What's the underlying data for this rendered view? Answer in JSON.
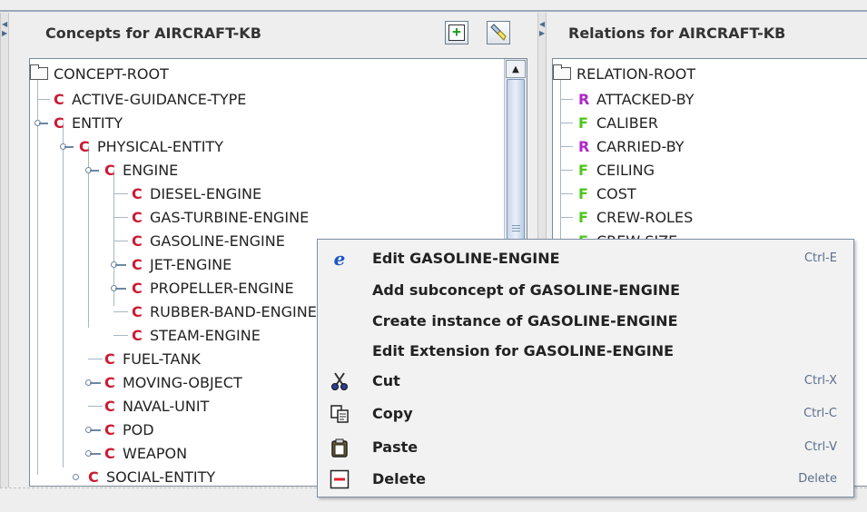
{
  "concepts_panel": {
    "title": "Concepts for AIRCRAFT-KB",
    "add_button_glyph": "+",
    "root": "CONCEPT-ROOT",
    "items": [
      {
        "tag": "C",
        "label": "ACTIVE-GUIDANCE-TYPE"
      },
      {
        "tag": "C",
        "label": "ENTITY"
      },
      {
        "tag": "C",
        "label": "PHYSICAL-ENTITY"
      },
      {
        "tag": "C",
        "label": "ENGINE"
      },
      {
        "tag": "C",
        "label": "DIESEL-ENGINE"
      },
      {
        "tag": "C",
        "label": "GAS-TURBINE-ENGINE"
      },
      {
        "tag": "C",
        "label": "GASOLINE-ENGINE"
      },
      {
        "tag": "C",
        "label": "JET-ENGINE"
      },
      {
        "tag": "C",
        "label": "PROPELLER-ENGINE"
      },
      {
        "tag": "C",
        "label": "RUBBER-BAND-ENGINE"
      },
      {
        "tag": "C",
        "label": "STEAM-ENGINE"
      },
      {
        "tag": "C",
        "label": "FUEL-TANK"
      },
      {
        "tag": "C",
        "label": "MOVING-OBJECT"
      },
      {
        "tag": "C",
        "label": "NAVAL-UNIT"
      },
      {
        "tag": "C",
        "label": "POD"
      },
      {
        "tag": "C",
        "label": "WEAPON"
      },
      {
        "tag": "C",
        "label": "SOCIAL-ENTITY"
      }
    ]
  },
  "relations_panel": {
    "title": "Relations for AIRCRAFT-KB",
    "root": "RELATION-ROOT",
    "items": [
      {
        "tag": "R",
        "label": "ATTACKED-BY"
      },
      {
        "tag": "F",
        "label": "CALIBER"
      },
      {
        "tag": "R",
        "label": "CARRIED-BY"
      },
      {
        "tag": "F",
        "label": "CEILING"
      },
      {
        "tag": "F",
        "label": "COST"
      },
      {
        "tag": "F",
        "label": "CREW-ROLES"
      },
      {
        "tag": "F",
        "label": "CREW-SIZE"
      }
    ]
  },
  "context_menu": {
    "items": [
      {
        "icon": "edit-e-icon",
        "label": "Edit GASOLINE-ENGINE",
        "accelerator": "Ctrl-E"
      },
      {
        "icon": "",
        "label": "Add subconcept of GASOLINE-ENGINE",
        "accelerator": ""
      },
      {
        "icon": "",
        "label": "Create instance of GASOLINE-ENGINE",
        "accelerator": ""
      },
      {
        "icon": "",
        "label": "Edit Extension for GASOLINE-ENGINE",
        "accelerator": ""
      },
      {
        "icon": "scissors-icon",
        "label": "Cut",
        "accelerator": "Ctrl-X"
      },
      {
        "icon": "copy-icon",
        "label": "Copy",
        "accelerator": "Ctrl-C"
      },
      {
        "icon": "paste-icon",
        "label": "Paste",
        "accelerator": "Ctrl-V"
      },
      {
        "icon": "delete-minus-icon",
        "label": "Delete",
        "accelerator": "Delete"
      }
    ]
  },
  "colors": {
    "concept_tag": "#cc1a33",
    "relation_tag": "#b026c8",
    "function_tag": "#4dc61a",
    "menu_accelerator": "#5a6f8c"
  }
}
